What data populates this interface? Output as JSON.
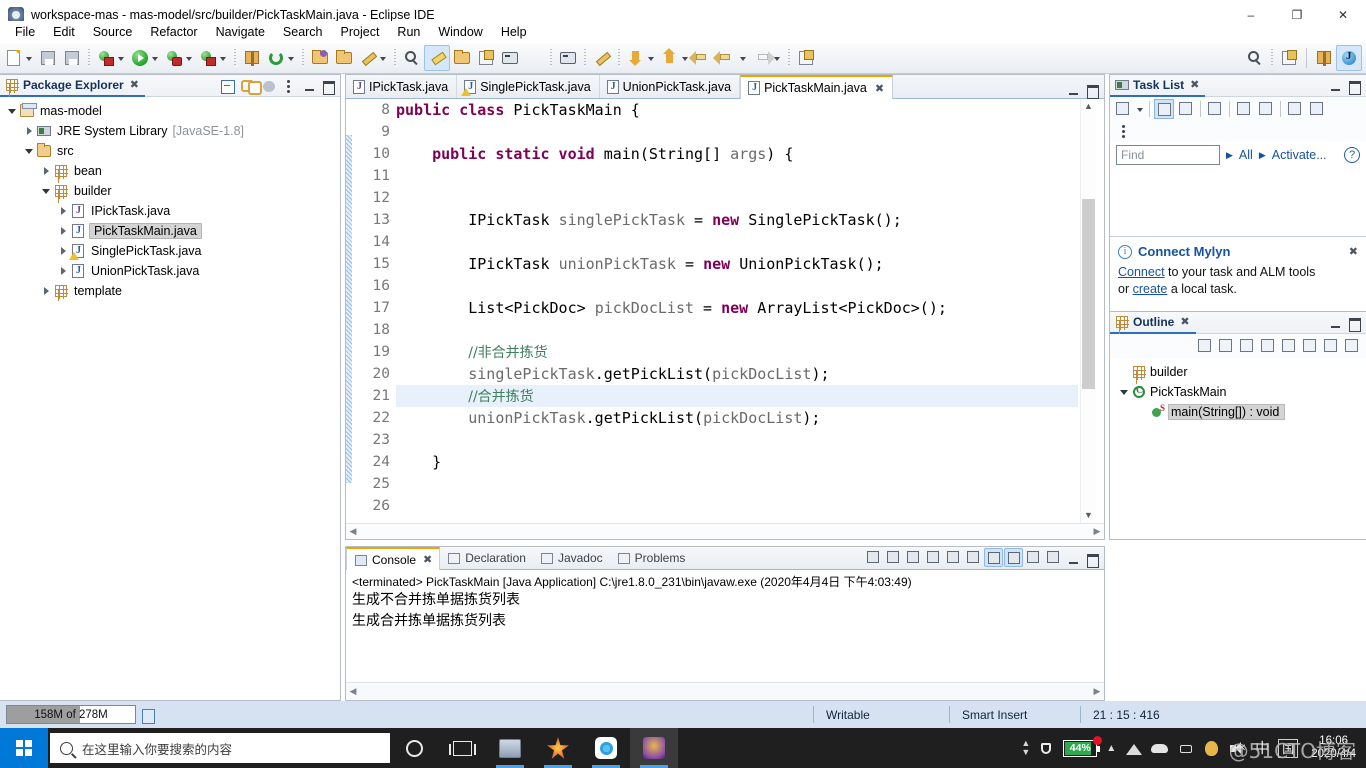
{
  "window": {
    "title": "workspace-mas - mas-model/src/builder/PickTaskMain.java - Eclipse IDE",
    "icon": "eclipse-icon",
    "minimize": "–",
    "maximize": "❐",
    "close": "✕"
  },
  "menu": {
    "items": [
      "File",
      "Edit",
      "Source",
      "Refactor",
      "Navigate",
      "Search",
      "Project",
      "Run",
      "Window",
      "Help"
    ]
  },
  "toolbar": {
    "groups": [
      {
        "items": [
          {
            "name": "new-icon",
            "cls": "ic-doc",
            "dropdown": true
          },
          {
            "name": "save-icon",
            "cls": "ic-save"
          },
          {
            "name": "save-all-icon",
            "cls": "ic-save"
          }
        ]
      },
      {
        "items": [
          {
            "name": "debug-icon",
            "cls": "ic-bug",
            "dropdown": true
          },
          {
            "name": "run-icon",
            "cls": "ic-green",
            "dropdown": true
          },
          {
            "name": "run-external-tools-icon",
            "cls": "ic-bug ic-bug2",
            "dropdown": true
          },
          {
            "name": "coverage-icon",
            "cls": "ic-bug",
            "dropdown": true
          }
        ]
      },
      {
        "items": [
          {
            "name": "new-package-icon",
            "cls": "ic-pkg"
          },
          {
            "name": "refresh-icon",
            "cls": "ic-refresh",
            "dropdown": true
          }
        ]
      },
      {
        "items": [
          {
            "name": "open-type-icon",
            "cls": "ic-folder purple"
          },
          {
            "name": "open-resource-icon",
            "cls": "ic-folder"
          },
          {
            "name": "quick-fix-icon",
            "cls": "ic-pencil",
            "dropdown": true
          }
        ]
      },
      {
        "items": [
          {
            "name": "search-field-icon",
            "cls": "ic-search-tb"
          },
          {
            "name": "toggle-mark-occurrences-icon",
            "cls": "ic-brush",
            "active": true
          },
          {
            "name": "skip-breakpoints-icon",
            "cls": "ic-folder"
          },
          {
            "name": "new-java-class-icon",
            "cls": "ic-persp"
          },
          {
            "name": "toggle-block-selection-icon",
            "cls": "ic-term"
          },
          {
            "name": "show-whitespace-icon",
            "cls": "ic-para"
          }
        ]
      },
      {
        "items": [
          {
            "name": "open-console-icon",
            "cls": "ic-term"
          }
        ]
      },
      {
        "items": [
          {
            "name": "pin-console-icon",
            "cls": "ic-pencil"
          }
        ]
      },
      {
        "items": [
          {
            "name": "previous-annotation-icon",
            "cls": "ic-arrowdown",
            "dropdown": true
          },
          {
            "name": "next-annotation-icon",
            "cls": "ic-arrowup",
            "dropdown": true
          },
          {
            "name": "back-icon",
            "cls": "ic-back"
          },
          {
            "name": "backward-history-icon",
            "cls": "ic-back",
            "dropdown": true
          },
          {
            "name": "forward-history-icon",
            "cls": "ic-fwd",
            "dropdown": true
          }
        ]
      },
      {
        "items": [
          {
            "name": "new-window-icon",
            "cls": "ic-persp"
          }
        ]
      }
    ],
    "right": [
      {
        "name": "search-icon",
        "cls": "ic-search-tb"
      },
      {
        "name": "open-perspective-icon",
        "cls": "ic-persp"
      },
      {
        "name": "perspective-java-ee-icon",
        "cls": "ic-pkg"
      },
      {
        "name": "perspective-java-icon",
        "cls": "ic-j",
        "active": true
      }
    ]
  },
  "package_explorer": {
    "title": "Package Explorer",
    "close_glyph": "✖",
    "actions": [
      {
        "name": "collapse-all-icon",
        "cls": "pe-collapse"
      },
      {
        "name": "link-with-editor-icon",
        "cls": "pe-link"
      },
      {
        "name": "focus-on-active-task-icon",
        "cls": "pe-focus"
      },
      {
        "name": "view-menu-icon",
        "cls": "pe-viewmenu"
      }
    ],
    "tree": [
      {
        "label": "mas-model",
        "indent": 0,
        "twist": "open",
        "icon": "i-proj",
        "name": "tree-item-mas-model"
      },
      {
        "label": "JRE System Library",
        "suffix": "[JavaSE-1.8]",
        "indent": 1,
        "twist": "closed",
        "icon": "i-jre",
        "name": "tree-item-jre-system-library"
      },
      {
        "label": "src",
        "indent": 1,
        "twist": "open",
        "icon": "i-src",
        "name": "tree-item-src"
      },
      {
        "label": "bean",
        "indent": 2,
        "twist": "closed",
        "icon": "i-pkgt",
        "name": "tree-item-bean"
      },
      {
        "label": "builder",
        "indent": 2,
        "twist": "open",
        "icon": "i-pkgt",
        "name": "tree-item-builder"
      },
      {
        "label": "IPickTask.java",
        "indent": 3,
        "twist": "closed",
        "icon": "i-java i-iface",
        "name": "tree-item-ipicktask-java"
      },
      {
        "label": "PickTaskMain.java",
        "indent": 3,
        "twist": "closed",
        "icon": "i-java",
        "selected": true,
        "name": "tree-item-picktaskmain-java"
      },
      {
        "label": "SinglePickTask.java",
        "indent": 3,
        "twist": "closed",
        "icon": "i-java",
        "warn": true,
        "name": "tree-item-singlepicktask-java"
      },
      {
        "label": "UnionPickTask.java",
        "indent": 3,
        "twist": "closed",
        "icon": "i-java",
        "name": "tree-item-unionpicktask-java"
      },
      {
        "label": "template",
        "indent": 2,
        "twist": "closed",
        "icon": "i-pkgt",
        "name": "tree-item-template"
      }
    ]
  },
  "editor": {
    "tabs": [
      {
        "label": "IPickTask.java",
        "icon": "java-interface-icon",
        "active": false
      },
      {
        "label": "SinglePickTask.java",
        "icon": "java-class-warning-icon",
        "active": false,
        "warn": true
      },
      {
        "label": "UnionPickTask.java",
        "icon": "java-class-icon",
        "active": false
      },
      {
        "label": "PickTaskMain.java",
        "icon": "java-class-icon",
        "active": true,
        "close_glyph": "✖"
      }
    ],
    "first_line": 8,
    "current_line": 21,
    "lines": [
      {
        "n": 8,
        "fold": false,
        "segments": [
          {
            "t": "public class ",
            "c": "kw"
          },
          {
            "t": "PickTaskMain {",
            "c": ""
          }
        ]
      },
      {
        "n": 9,
        "fold": false,
        "segments": []
      },
      {
        "n": 10,
        "fold": true,
        "segments": [
          {
            "t": "    ",
            "c": ""
          },
          {
            "t": "public static void ",
            "c": "kw"
          },
          {
            "t": "main(String[] ",
            "c": ""
          },
          {
            "t": "args",
            "c": "var"
          },
          {
            "t": ") {",
            "c": ""
          }
        ]
      },
      {
        "n": 11,
        "fold": false,
        "segments": []
      },
      {
        "n": 12,
        "fold": false,
        "segments": []
      },
      {
        "n": 13,
        "fold": false,
        "segments": [
          {
            "t": "        IPickTask ",
            "c": ""
          },
          {
            "t": "singlePickTask",
            "c": "var"
          },
          {
            "t": " = ",
            "c": ""
          },
          {
            "t": "new ",
            "c": "kw"
          },
          {
            "t": "SinglePickTask();",
            "c": ""
          }
        ]
      },
      {
        "n": 14,
        "fold": false,
        "segments": []
      },
      {
        "n": 15,
        "fold": false,
        "segments": [
          {
            "t": "        IPickTask ",
            "c": ""
          },
          {
            "t": "unionPickTask",
            "c": "var"
          },
          {
            "t": " = ",
            "c": ""
          },
          {
            "t": "new ",
            "c": "kw"
          },
          {
            "t": "UnionPickTask();",
            "c": ""
          }
        ]
      },
      {
        "n": 16,
        "fold": false,
        "segments": []
      },
      {
        "n": 17,
        "fold": false,
        "segments": [
          {
            "t": "        List<PickDoc> ",
            "c": ""
          },
          {
            "t": "pickDocList",
            "c": "var"
          },
          {
            "t": " = ",
            "c": ""
          },
          {
            "t": "new ",
            "c": "kw"
          },
          {
            "t": "ArrayList<PickDoc>();",
            "c": ""
          }
        ]
      },
      {
        "n": 18,
        "fold": false,
        "segments": []
      },
      {
        "n": 19,
        "fold": false,
        "segments": [
          {
            "t": "        ",
            "c": ""
          },
          {
            "t": "//非合并拣货",
            "c": "cmt-cn"
          }
        ]
      },
      {
        "n": 20,
        "fold": false,
        "segments": [
          {
            "t": "        ",
            "c": ""
          },
          {
            "t": "singlePickTask",
            "c": "var"
          },
          {
            "t": ".getPickList(",
            "c": ""
          },
          {
            "t": "pickDocList",
            "c": "var"
          },
          {
            "t": ");",
            "c": ""
          }
        ]
      },
      {
        "n": 21,
        "fold": false,
        "current": true,
        "segments": [
          {
            "t": "        ",
            "c": ""
          },
          {
            "t": "//合并拣货",
            "c": "cmt-cn"
          }
        ]
      },
      {
        "n": 22,
        "fold": false,
        "segments": [
          {
            "t": "        ",
            "c": ""
          },
          {
            "t": "unionPickTask",
            "c": "var"
          },
          {
            "t": ".getPickList(",
            "c": ""
          },
          {
            "t": "pickDocList",
            "c": "var"
          },
          {
            "t": ");",
            "c": ""
          }
        ]
      },
      {
        "n": 23,
        "fold": false,
        "segments": []
      },
      {
        "n": 24,
        "fold": false,
        "segments": [
          {
            "t": "    }",
            "c": ""
          }
        ]
      },
      {
        "n": 25,
        "fold": false,
        "segments": []
      },
      {
        "n": 26,
        "fold": false,
        "segments": []
      }
    ]
  },
  "console": {
    "tabs": [
      {
        "label": "Problems",
        "icon": "problems-icon",
        "active": false
      },
      {
        "label": "Javadoc",
        "icon": "javadoc-icon",
        "active": false
      },
      {
        "label": "Declaration",
        "icon": "declaration-icon",
        "active": false
      },
      {
        "label": "Console",
        "icon": "console-icon",
        "active": true,
        "close_glyph": "✖"
      }
    ],
    "actions": [
      {
        "name": "terminate-icon",
        "active": false
      },
      {
        "name": "remove-launch-icon",
        "active": false
      },
      {
        "name": "remove-all-terminated-icon",
        "active": false
      },
      {
        "name": "clear-console-icon",
        "active": false
      },
      {
        "name": "lock-scroll-icon",
        "active": false
      },
      {
        "name": "show-console-on-output-icon",
        "active": false
      },
      {
        "name": "pin-console-icon",
        "active": true
      },
      {
        "name": "display-selected-console-icon",
        "active": true
      },
      {
        "name": "open-console-icon",
        "active": false
      },
      {
        "name": "new-console-view-icon",
        "active": false
      }
    ],
    "header": "<terminated> PickTaskMain [Java Application] C:\\jre1.8.0_231\\bin\\javaw.exe (2020年4月4日 下午4:03:49)",
    "output": [
      "生成不合并拣单据拣货列表",
      "生成合并拣单据拣货列表"
    ]
  },
  "task_list": {
    "title": "Task List",
    "close_glyph": "✖",
    "toolbar": [
      {
        "name": "new-task-icon",
        "dropdown": true
      },
      {
        "name": "categorized-presentation-icon",
        "active": true
      },
      {
        "name": "scheduled-presentation-icon"
      },
      {
        "name": "focus-on-workweek-icon"
      },
      {
        "name": "collapse-all-icon"
      },
      {
        "name": "synchronize-changed-icon"
      },
      {
        "name": "minimize-all-icon"
      },
      {
        "name": "restore-icon"
      }
    ],
    "find_placeholder": "Find",
    "find_value": "",
    "filter_all": "All",
    "filter_activate": "Activate...",
    "help_glyph": "?",
    "mylyn": {
      "title": "Connect Mylyn",
      "close_glyph": "✖",
      "line1_link": "Connect",
      "line1_rest": " to your task and ALM tools",
      "line2_pre": "or ",
      "line2_link": "create",
      "line2_rest": " a local task."
    }
  },
  "outline": {
    "title": "Outline",
    "close_glyph": "✖",
    "toolbar": [
      {
        "name": "focus-on-active-task-icon"
      },
      {
        "name": "collapse-all-icon"
      },
      {
        "name": "sort-icon"
      },
      {
        "name": "hide-fields-icon"
      },
      {
        "name": "hide-static-icon"
      },
      {
        "name": "hide-non-public-icon"
      },
      {
        "name": "hide-local-types-icon"
      },
      {
        "name": "view-menu-icon"
      }
    ],
    "tree": [
      {
        "label": "builder",
        "indent": 0,
        "twist": "none",
        "icon": "pkg",
        "name": "outline-item-builder"
      },
      {
        "label": "PickTaskMain",
        "indent": 0,
        "twist": "open",
        "icon": "class",
        "name": "outline-item-picktaskmain"
      },
      {
        "label": "main(String[]) : void",
        "indent": 1,
        "twist": "none",
        "icon": "method",
        "selected": true,
        "name": "outline-item-main-method"
      }
    ]
  },
  "status_bar": {
    "memory": "158M of 278M",
    "writable": "Writable",
    "insert_mode": "Smart Insert",
    "position": "21 : 15 : 416"
  },
  "taskbar": {
    "search_placeholder": "在这里输入你要搜索的内容",
    "apps": [
      {
        "name": "cortana-icon"
      },
      {
        "name": "task-view-icon"
      },
      {
        "name": "file-explorer-icon"
      },
      {
        "name": "media-app-icon"
      },
      {
        "name": "browser-app-icon"
      },
      {
        "name": "eclipse-app-icon",
        "active": true
      }
    ],
    "tray": {
      "battery_percent": "44%",
      "lang": "中",
      "ime": "国",
      "time": "16:06",
      "date": "2020/4/4",
      "watermark": "@51CTO博客"
    }
  },
  "colors": {
    "accent": "#2f6fb5",
    "tab_active": "#f0a400",
    "keyword": "#7f0055",
    "comment": "#3f7f5f",
    "current_line": "#e8f0fb",
    "status_bar": "#d6e2f2",
    "taskbar": "#1f1f1f"
  }
}
